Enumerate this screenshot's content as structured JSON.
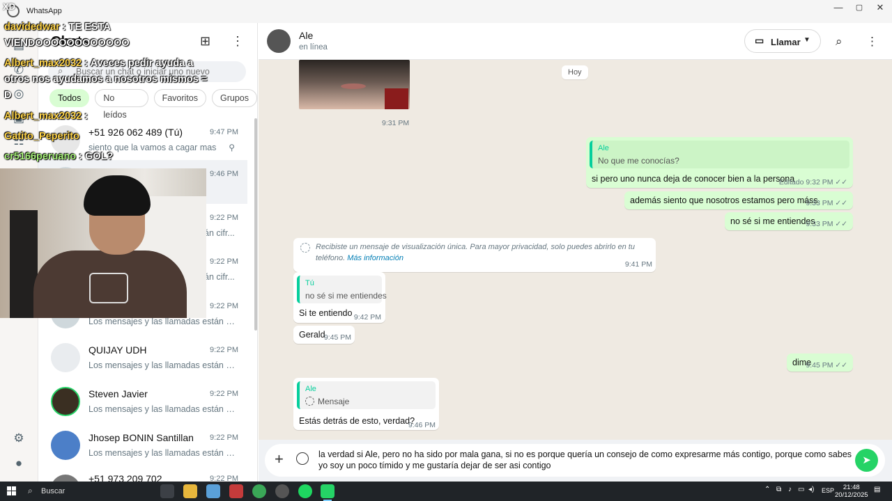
{
  "window": {
    "title": "WhatsApp",
    "min": "—",
    "max": "▢",
    "close": "✕"
  },
  "list": {
    "title": "Chats",
    "search_placeholder": "Buscar un chat o iniciar uno nuevo",
    "filters": [
      "Todos",
      "No leídos",
      "Favoritos",
      "Grupos"
    ],
    "chats": [
      {
        "name": "+51 926 062 489 (Tú)",
        "time": "9:47 PM",
        "preview": "siento que la vamos a cagar mas"
      },
      {
        "name": "",
        "time": "9:46 PM",
        "preview": ""
      },
      {
        "name": "",
        "time": "9:22 PM",
        "preview": "án cifr..."
      },
      {
        "name": "",
        "time": "9:22 PM",
        "preview": "án cifr..."
      },
      {
        "name": "",
        "time": "9:22 PM",
        "preview": "Los mensajes y las llamadas están cifr..."
      },
      {
        "name": "QUIJAY UDH",
        "time": "9:22 PM",
        "preview": "Los mensajes y las llamadas están cifr..."
      },
      {
        "name": "Steven Javier",
        "time": "9:22 PM",
        "preview": "Los mensajes y las llamadas están cifr..."
      },
      {
        "name": "Jhosep BONIN Santillan",
        "time": "9:22 PM",
        "preview": "Los mensajes y las llamadas están cifr..."
      },
      {
        "name": "+51 973 209 702",
        "time": "9:22 PM",
        "preview": ""
      }
    ]
  },
  "conversation": {
    "name": "Ale",
    "status": "en línea",
    "call_label": "Llamar",
    "date_chip": "Hoy",
    "photo_time": "9:31 PM",
    "out1": {
      "quote_author": "Ale",
      "quote_text": "No que me conocías?",
      "text": "si pero uno nunca deja de conocer bien a la persona",
      "meta": "Editado 9:32 PM ✓✓"
    },
    "out2": {
      "text": "además siento que nosotros estamos pero máss",
      "meta": "9:33 PM ✓✓"
    },
    "out3": {
      "text": "no sé si me entiendes",
      "meta": "9:33 PM ✓✓"
    },
    "system": {
      "line1": "Recibiste un mensaje de visualización única. Para mayor privacidad, solo puedes abrirlo en tu",
      "line2": "teléfono.",
      "link": "Más información",
      "time": "9:41 PM"
    },
    "in1": {
      "quote_author": "Tú",
      "quote_text": "no sé si me entiendes",
      "text": "Si te entiendo",
      "meta": "9:42 PM"
    },
    "in2": {
      "text": "Gerald",
      "meta": "9:45 PM"
    },
    "out4": {
      "text": "dime",
      "meta": "9:45 PM ✓✓"
    },
    "in3": {
      "quote_author": "Ale",
      "quote_text": "Mensaje",
      "text": "Estás detrás de esto, verdad?",
      "meta": "9:46 PM"
    },
    "draft": "la verdad si Ale, pero no ha sido por mala gana, si no es porque quería un consejo de como expresarme más contigo, porque como sabes yo soy un poco tímido y me gustaría dejar de ser asi contigo"
  },
  "overlay": {
    "tag": "XD",
    "messages": [
      {
        "user": "davidedwar",
        "text": " : TE ESTA"
      },
      {
        "user": "",
        "text": "VIENDOOOOOOOOOOOO"
      },
      {
        "user": "Albert_max2032",
        "text": " : Aveces pedir ayuda a"
      },
      {
        "user": "",
        "text": "otros nos ayudamos a nosotros mismos ="
      },
      {
        "user": "",
        "text": "D"
      },
      {
        "user": "Albert_max2032",
        "text": " : "
      },
      {
        "user": "Gatito_Peperito",
        "text": ""
      },
      {
        "user": "cr5166peruano",
        "text": " : GOL?"
      }
    ]
  },
  "taskbar": {
    "search_label": "Buscar",
    "lang": "ESP",
    "time": "21:48",
    "date": "20/12/2025"
  },
  "colors": {
    "accent": "#25d366",
    "outgoing": "#d9fdd3",
    "wallpaper": "#efeae2",
    "quote_bar": "#06cf9c"
  }
}
